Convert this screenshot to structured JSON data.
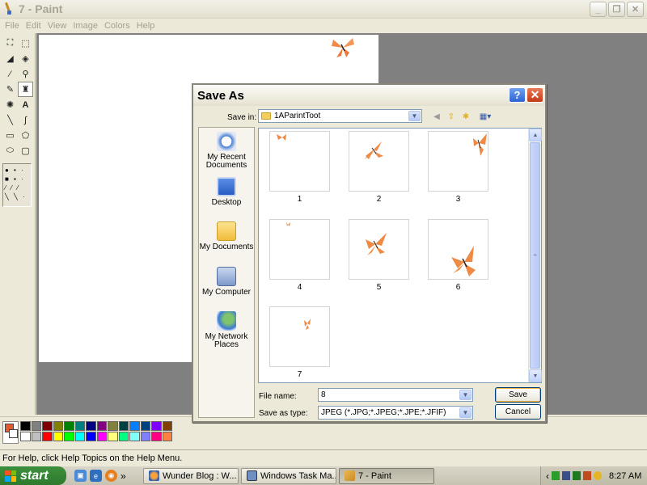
{
  "window": {
    "title": "7 - Paint"
  },
  "menu": [
    "File",
    "Edit",
    "View",
    "Image",
    "Colors",
    "Help"
  ],
  "palette_colors": [
    "#000000",
    "#808080",
    "#800000",
    "#808000",
    "#008000",
    "#008080",
    "#000080",
    "#800080",
    "#808040",
    "#004040",
    "#0080ff",
    "#004080",
    "#8000ff",
    "#804000",
    "#ffffff",
    "#c0c0c0",
    "#ff0000",
    "#ffff00",
    "#00ff00",
    "#00ffff",
    "#0000ff",
    "#ff00ff",
    "#ffff80",
    "#00ff80",
    "#80ffff",
    "#8080ff",
    "#ff0080",
    "#ff8040"
  ],
  "status": {
    "help_text": "For Help, click Help Topics on the Help Menu."
  },
  "dialog": {
    "title": "Save As",
    "save_in_label": "Save in:",
    "save_in_value": "1AParintToot",
    "places": [
      "My Recent Documents",
      "Desktop",
      "My Documents",
      "My Computer",
      "My Network Places"
    ],
    "files": [
      "1",
      "2",
      "3",
      "4",
      "5",
      "6",
      "7"
    ],
    "file_name_label": "File name:",
    "file_name_value": "8",
    "save_as_type_label": "Save as type:",
    "save_as_type_value": "JPEG (*.JPG;*.JPEG;*.JPE;*.JFIF)",
    "save_button": "Save",
    "cancel_button": "Cancel"
  },
  "taskbar": {
    "start": "start",
    "overflow_glyph": "»",
    "items": [
      "Wunder Blog : W...",
      "Windows Task Ma...",
      "7 - Paint"
    ],
    "clock": "8:27 AM"
  }
}
